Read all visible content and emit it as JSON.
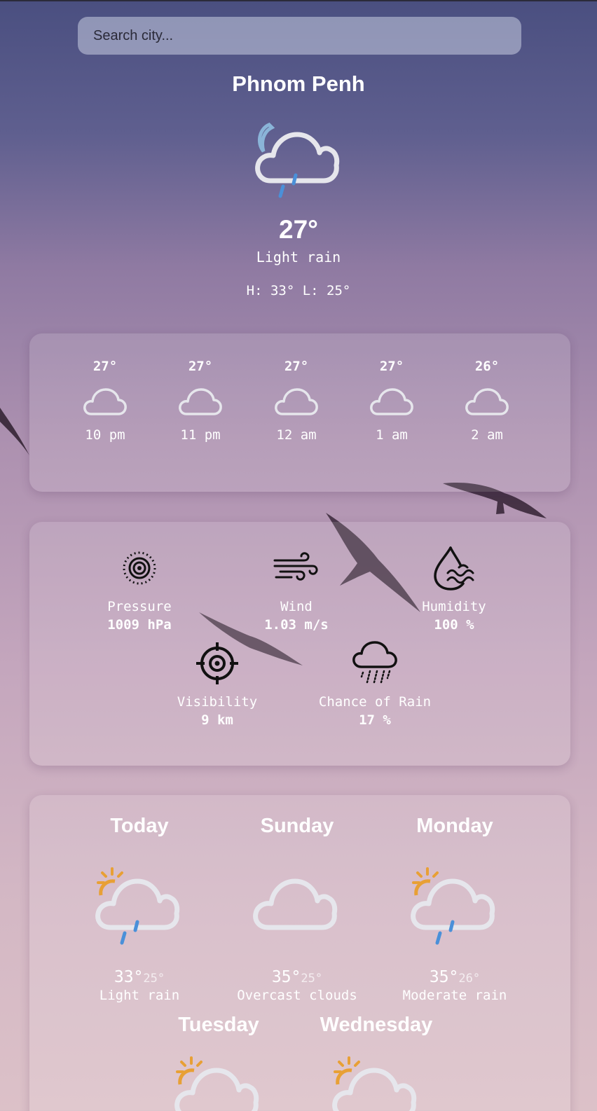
{
  "search": {
    "placeholder": "Search city..."
  },
  "current": {
    "city": "Phnom Penh",
    "temp": "27°",
    "description": "Light rain",
    "high_low": "H: 33° L: 25°",
    "icon": "moon-cloud-rain-icon"
  },
  "hourly": [
    {
      "temp": "27°",
      "time": "10 pm",
      "icon": "cloud-icon"
    },
    {
      "temp": "27°",
      "time": "11 pm",
      "icon": "cloud-icon"
    },
    {
      "temp": "27°",
      "time": "12 am",
      "icon": "cloud-icon"
    },
    {
      "temp": "27°",
      "time": "1 am",
      "icon": "cloud-icon"
    },
    {
      "temp": "26°",
      "time": "2 am",
      "icon": "cloud-icon"
    }
  ],
  "details": [
    {
      "label": "Pressure",
      "value": "1009 hPa",
      "icon": "pressure-icon"
    },
    {
      "label": "Wind",
      "value": "1.03 m/s",
      "icon": "wind-icon"
    },
    {
      "label": "Humidity",
      "value": "100 %",
      "icon": "humidity-icon"
    },
    {
      "label": "Visibility",
      "value": "9 km",
      "icon": "visibility-icon"
    },
    {
      "label": "Chance of Rain",
      "value": "17 %",
      "icon": "rain-cloud-icon"
    }
  ],
  "forecast": [
    {
      "day": "Today",
      "high": "33°",
      "low": "25°",
      "description": "Light rain",
      "icon": "sun-cloud-rain-icon"
    },
    {
      "day": "Sunday",
      "high": "35°",
      "low": "25°",
      "description": "Overcast clouds",
      "icon": "cloud-icon"
    },
    {
      "day": "Monday",
      "high": "35°",
      "low": "26°",
      "description": "Moderate rain",
      "icon": "sun-cloud-rain-icon"
    },
    {
      "day": "Tuesday",
      "icon": "sun-cloud-icon"
    },
    {
      "day": "Wednesday",
      "icon": "sun-cloud-icon"
    }
  ],
  "colors": {
    "sun": "#e8a035",
    "rain": "#4a90d9",
    "moon": "#8ab4d8",
    "cloud_outline": "#e6e6ec"
  }
}
